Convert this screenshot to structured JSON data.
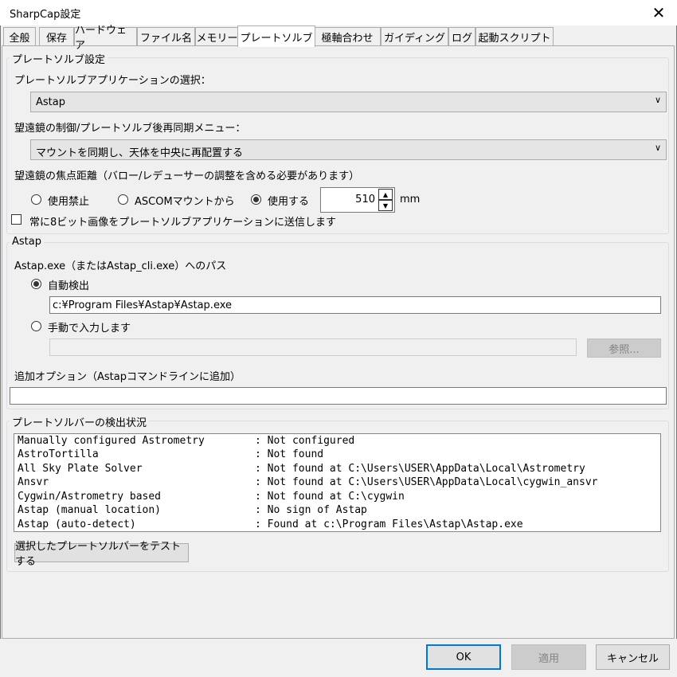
{
  "window": {
    "title": "SharpCap設定",
    "close_glyph": "✕"
  },
  "tabs": [
    {
      "label": "全般",
      "active": false
    },
    {
      "label": "保存",
      "active": false
    },
    {
      "label": "ハードウェア",
      "active": false
    },
    {
      "label": "ファイル名",
      "active": false
    },
    {
      "label": "メモリー",
      "active": false
    },
    {
      "label": "プレートソルブ",
      "active": true
    },
    {
      "label": "極軸合わせ",
      "active": false
    },
    {
      "label": "ガイディング",
      "active": false
    },
    {
      "label": "ログ",
      "active": false
    },
    {
      "label": "起動スクリプト",
      "active": false
    }
  ],
  "platesolve": {
    "group_title": "プレートソルブ設定",
    "app_select_label": "プレートソルブアプリケーションの選択：",
    "app_select_value": "Astap",
    "telescope_menu_label": "望遠鏡の制御/プレートソルブ後再同期メニュー：",
    "telescope_menu_value": "マウントを同期し、天体を中央に再配置する",
    "focal_label": "望遠鏡の焦点距離（バロー/レデューサーの調整を含める必要があります）",
    "focal_options": [
      {
        "label": "使用禁止",
        "checked": false
      },
      {
        "label": "ASCOMマウントから",
        "checked": false
      },
      {
        "label": "使用する",
        "checked": true
      }
    ],
    "focal_value": "510",
    "focal_unit": "mm",
    "send8bit_label": "常に8ビット画像をプレートソルブアプリケーションに送信します",
    "send8bit_checked": false
  },
  "astap": {
    "group_title": "Astap",
    "path_label": "Astap.exe（またはAstap_cli.exe）へのパス",
    "auto_label": "自動検出",
    "auto_checked": true,
    "auto_path": "c:¥Program Files¥Astap¥Astap.exe",
    "manual_label": "手動で入力します",
    "manual_checked": false,
    "manual_path": "",
    "browse_label": "参照...",
    "extra_label": "追加オプション（Astapコマンドラインに追加）",
    "extra_value": ""
  },
  "detection": {
    "group_title": "プレートソルバーの検出状況",
    "rows": [
      {
        "name": "Manually configured Astrometry",
        "status": ": Not configured"
      },
      {
        "name": "AstroTortilla",
        "status": ": Not found"
      },
      {
        "name": "All Sky Plate Solver",
        "status": ": Not found at C:\\Users\\USER\\AppData\\Local\\Astrometry"
      },
      {
        "name": "Ansvr",
        "status": ": Not found at C:\\Users\\USER\\AppData\\Local\\cygwin_ansvr"
      },
      {
        "name": "Cygwin/Astrometry based",
        "status": ": Not found at C:\\cygwin"
      },
      {
        "name": "Astap (manual location)",
        "status": ": No sign of Astap"
      },
      {
        "name": "Astap (auto-detect)",
        "status": ": Found at c:\\Program Files\\Astap\\Astap.exe"
      }
    ],
    "test_button": "選択したプレートソルバーをテストする"
  },
  "footer": {
    "ok": "OK",
    "apply": "適用",
    "cancel": "キャンセル"
  }
}
